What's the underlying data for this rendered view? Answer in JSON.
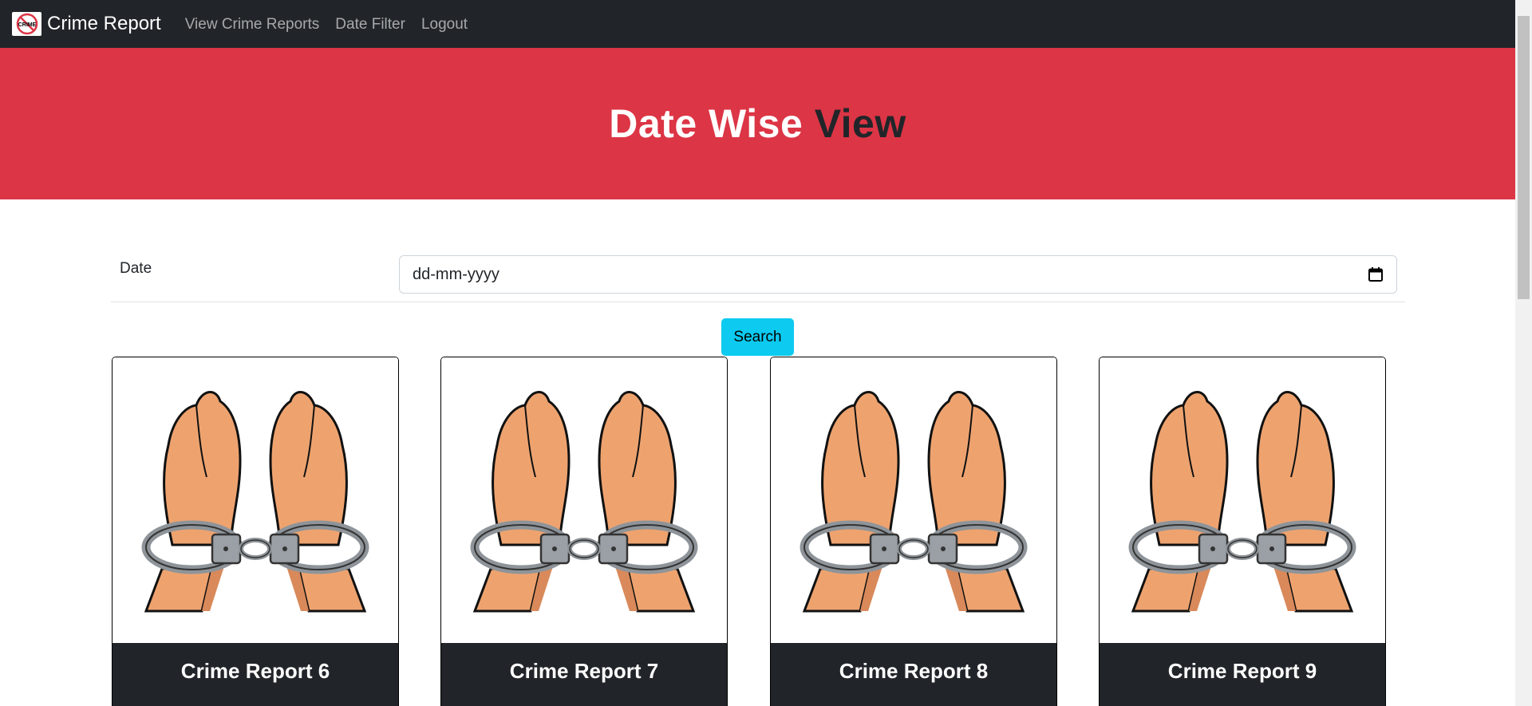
{
  "navbar": {
    "brand_logo_text": "CRIME",
    "brand": "Crime Report",
    "links": [
      "View Crime Reports",
      "Date Filter",
      "Logout"
    ]
  },
  "hero": {
    "title_light": "Date Wise ",
    "title_dark": "View"
  },
  "form": {
    "date_label": "Date",
    "date_placeholder": "dd-mm-yyyy",
    "search_label": "Search"
  },
  "cards": [
    {
      "title": "Crime Report 6",
      "image": "handcuffed-hands-icon"
    },
    {
      "title": "Crime Report 7",
      "image": "handcuffed-hands-icon"
    },
    {
      "title": "Crime Report 8",
      "image": "handcuffed-hands-icon"
    },
    {
      "title": "Crime Report 9",
      "image": "handcuffed-hands-icon"
    }
  ],
  "colors": {
    "navbar": "#212529",
    "hero": "#dc3545",
    "search_button": "#0dcaf0",
    "card_footer": "#212529"
  }
}
